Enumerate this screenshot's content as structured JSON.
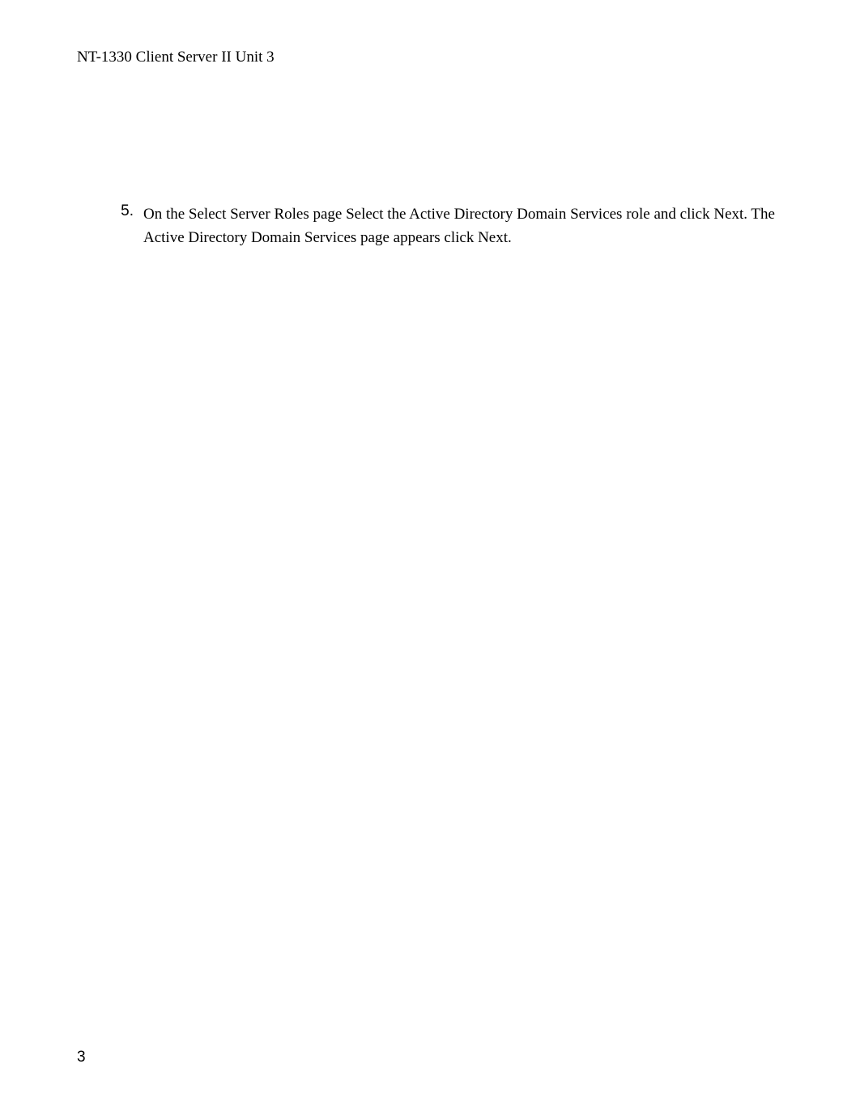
{
  "header": {
    "text": "NT-1330 Client Server II Unit 3"
  },
  "list": {
    "number": "5.",
    "content": "On the Select Server Roles page Select the Active Directory Domain Services role and click Next. The Active Directory Domain Services page appears click Next."
  },
  "footer": {
    "pageNumber": "3"
  }
}
